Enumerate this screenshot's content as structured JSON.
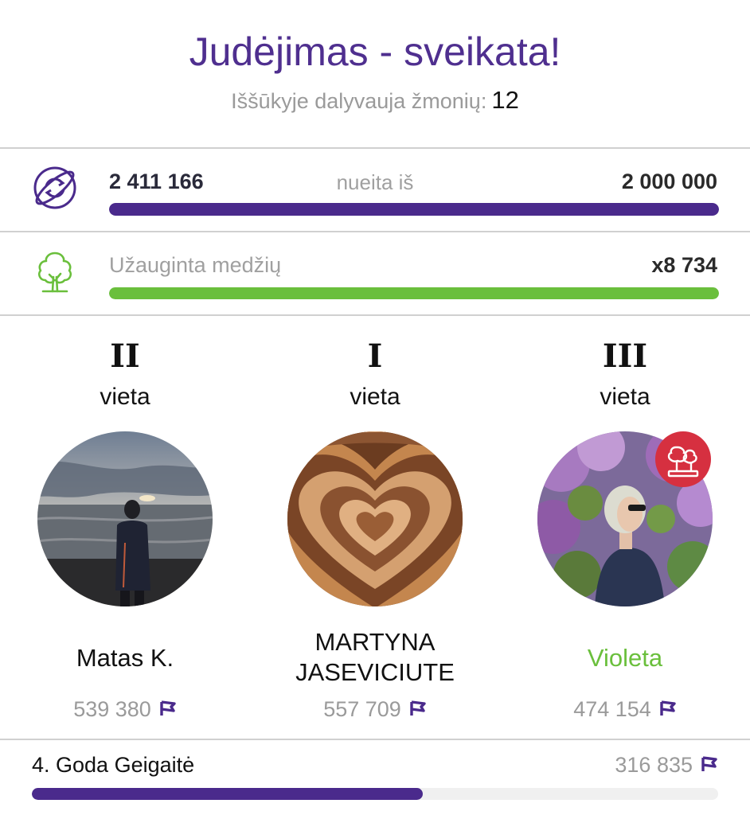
{
  "header": {
    "title": "Judėjimas - sveikata!",
    "participants_label": "Iššūkyje dalyvauja žmonių:",
    "participants_count": "12"
  },
  "distance": {
    "icon": "globe-sync-icon",
    "walked": "2 411 166",
    "middle_label": "nueita iš",
    "goal": "2 000 000",
    "progress": 1.0,
    "color": "#4a2a8c"
  },
  "trees": {
    "icon": "tree-icon",
    "label": "Užauginta medžių",
    "value": "x8 734",
    "progress": 1.0,
    "color": "#6abf3c"
  },
  "podium": [
    {
      "rank": "II",
      "rank_word": "vieta",
      "name": "Matas K.",
      "score": "539 380",
      "avatar": "photo-boy-at-sea-sunset",
      "name_color": "#111111"
    },
    {
      "rank": "I",
      "rank_word": "vieta",
      "name": "MARTYNA JASEVICIUTE",
      "score": "557 709",
      "avatar": "brown-concentric-hearts",
      "name_color": "#111111"
    },
    {
      "rank": "III",
      "rank_word": "vieta",
      "name": "Violeta",
      "score": "474 154",
      "avatar": "photo-woman-lilacs",
      "name_color": "#6abf3c",
      "badge": "trees-badge-icon"
    }
  ],
  "list": [
    {
      "label": "4. Goda Geigaitė",
      "score": "316 835",
      "progress": 0.57,
      "color": "#4a2a8c"
    }
  ],
  "colors": {
    "primary": "#4a2a8c",
    "title": "#4f2f8f",
    "green": "#6abf3c",
    "muted": "#9a9a9a",
    "badge": "#d63040"
  }
}
